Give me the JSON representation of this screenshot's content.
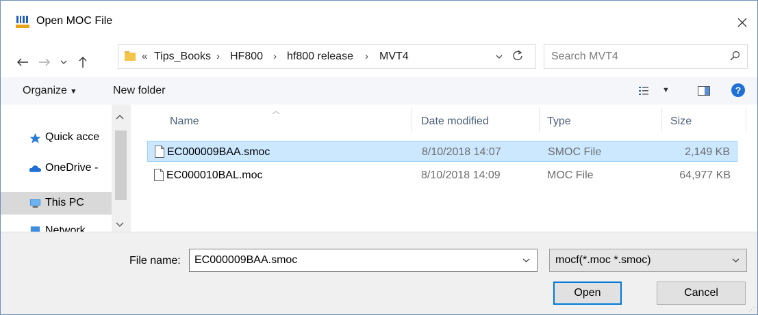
{
  "window": {
    "title": "Open MOC File"
  },
  "address": {
    "crumbs": [
      "Tips_Books",
      "HF800",
      "hf800 release",
      "MVT4"
    ],
    "overflow": "«",
    "separator": "›"
  },
  "search": {
    "placeholder": "Search MVT4"
  },
  "toolbar": {
    "organize": "Organize",
    "new_folder": "New folder"
  },
  "nav": {
    "items": [
      {
        "label": "Quick acce",
        "icon": "star-icon"
      },
      {
        "label": "OneDrive -",
        "icon": "cloud-icon"
      },
      {
        "label": "This PC",
        "icon": "computer-icon"
      },
      {
        "label": "Network",
        "icon": "network-icon"
      }
    ]
  },
  "columns": {
    "name": "Name",
    "date": "Date modified",
    "type": "Type",
    "size": "Size"
  },
  "files": [
    {
      "name": "EC000009BAA.smoc",
      "date": "8/10/2018 14:07",
      "type": "SMOC File",
      "size": "2,149 KB",
      "selected": true
    },
    {
      "name": "EC000010BAL.moc",
      "date": "8/10/2018 14:09",
      "type": "MOC File",
      "size": "64,977 KB",
      "selected": false
    }
  ],
  "bottom": {
    "file_name_label": "File name:",
    "file_name_value": "EC000009BAA.smoc",
    "file_type": "mocf(*.moc *.smoc)",
    "open": "Open",
    "cancel": "Cancel"
  },
  "colors": {
    "selection": "#cce8ff",
    "accent": "#0078d7"
  }
}
